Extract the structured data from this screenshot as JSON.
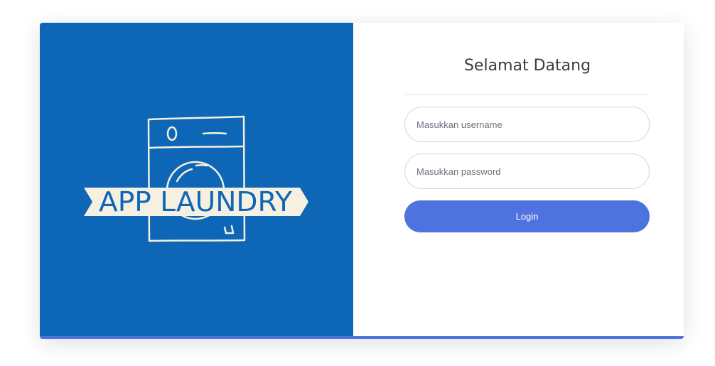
{
  "brand": {
    "logo_text": "APP LAUNDRY"
  },
  "login": {
    "title": "Selamat Datang",
    "username_placeholder": "Masukkan username",
    "password_placeholder": "Masukkan password",
    "login_label": "Login"
  },
  "colors": {
    "panel_blue": "#0e67b6",
    "primary": "#4e73df",
    "logo_cream": "#f5f0e1"
  },
  "icons": {
    "logo": "washing-machine-icon"
  }
}
